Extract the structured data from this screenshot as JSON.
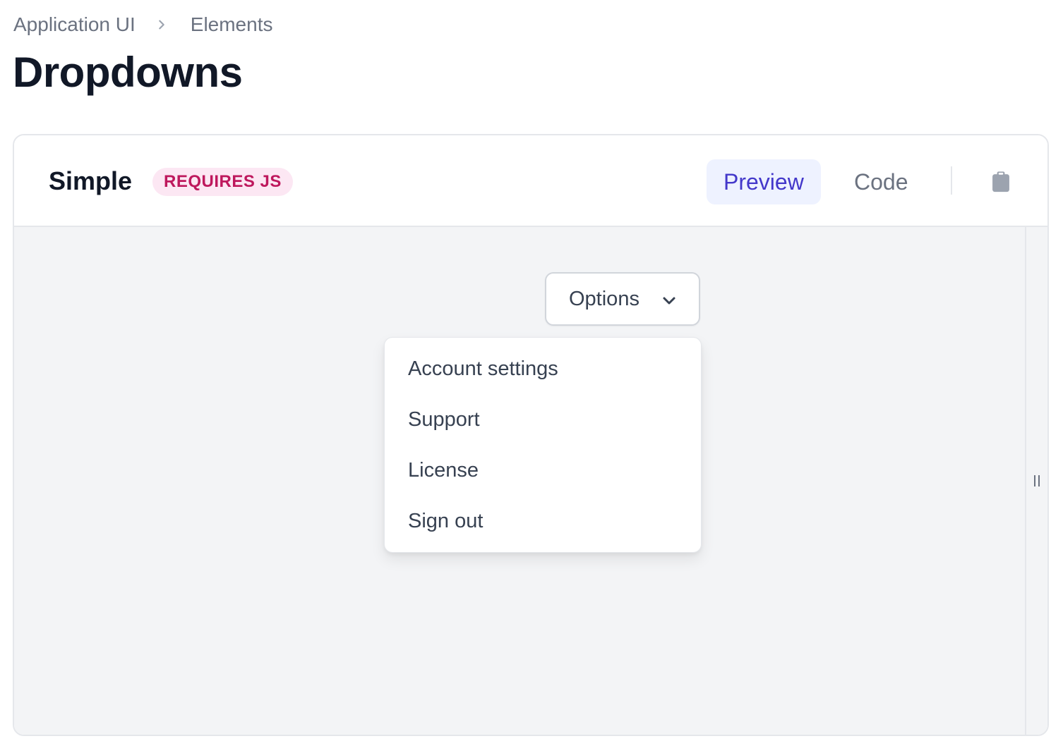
{
  "breadcrumb": {
    "items": [
      "Application UI",
      "Elements"
    ],
    "separator_icon": "chevron-right-icon"
  },
  "page": {
    "title": "Dropdowns"
  },
  "card": {
    "title": "Simple",
    "badge": "REQUIRES JS",
    "tabs": [
      {
        "label": "Preview",
        "active": true
      },
      {
        "label": "Code",
        "active": false
      }
    ],
    "copy_icon": "clipboard-icon"
  },
  "preview": {
    "dropdown_button": {
      "label": "Options",
      "icon": "chevron-down-icon"
    },
    "menu_items": [
      "Account settings",
      "Support",
      "License",
      "Sign out"
    ],
    "resize_icon": "resize-handle-icon"
  },
  "colors": {
    "accent": "#4338ca",
    "accent_bg": "#eef2ff",
    "badge_text": "#be185d",
    "badge_bg": "#fce7f3",
    "preview_bg": "#f3f4f6",
    "border": "#e5e7eb"
  }
}
